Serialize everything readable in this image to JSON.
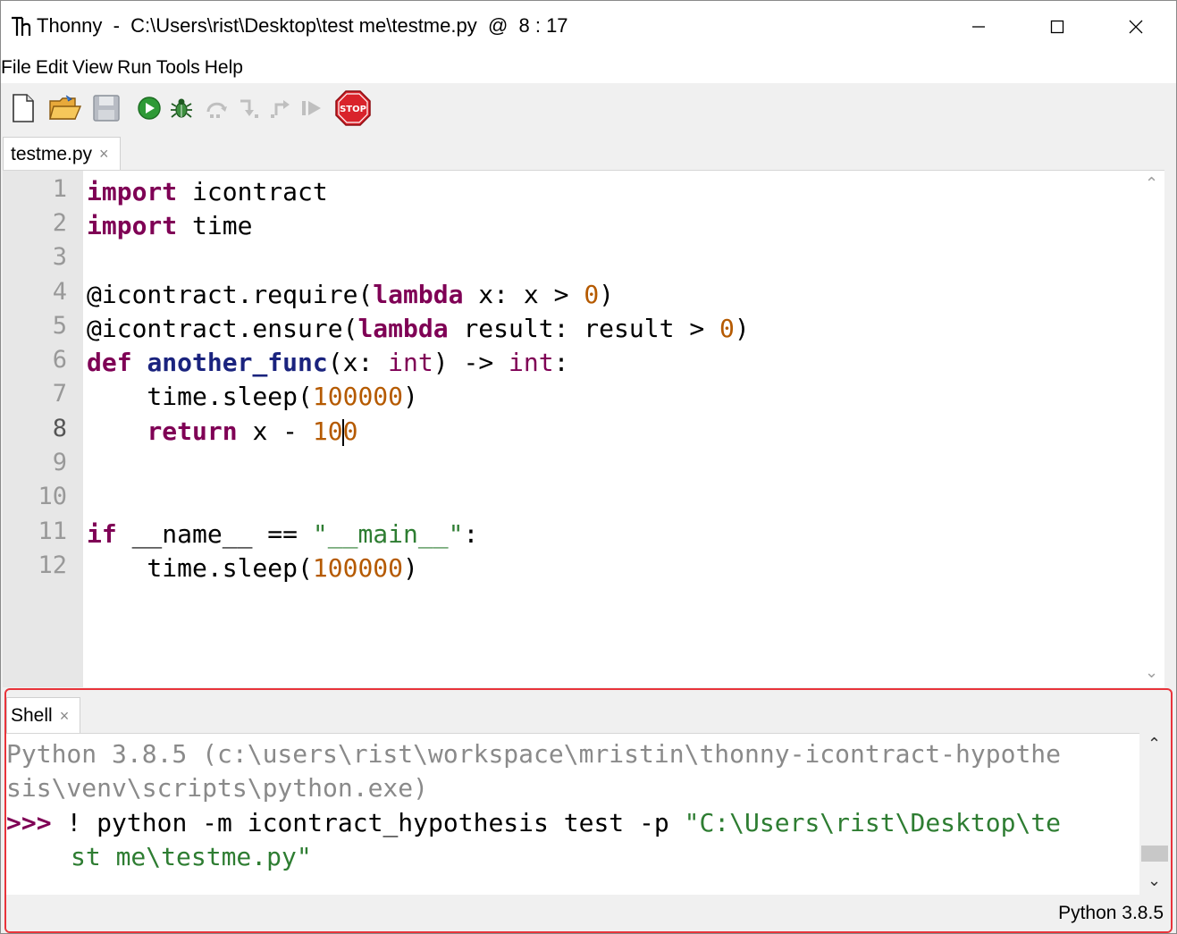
{
  "window": {
    "app_name": "Thonny",
    "separator": "  -  ",
    "path": "C:\\Users\\rist\\Desktop\\test me\\testme.py",
    "position_label": "  @  8 : 17"
  },
  "menu": [
    "File",
    "Edit",
    "View",
    "Run",
    "Tools",
    "Help"
  ],
  "toolbar": {
    "icons": [
      "new-file-icon",
      "open-folder-icon",
      "save-icon",
      "run-icon",
      "debug-bug-icon",
      "step-over-icon",
      "step-into-icon",
      "step-out-icon",
      "resume-icon",
      "stop-icon"
    ],
    "stop_label": "STOP"
  },
  "editor": {
    "tab_label": "testme.py",
    "tab_close": "×",
    "line_numbers": [
      "1",
      "2",
      "3",
      "4",
      "5",
      "6",
      "7",
      "8",
      "9",
      "10",
      "11",
      "12"
    ],
    "lines": [
      "import icontract",
      "import time",
      "",
      "@icontract.require(lambda x: x > 0)",
      "@icontract.ensure(lambda result: result > 0)",
      "def another_func(x: int) -> int:",
      "    time.sleep(100000)",
      "    return x - 100",
      "",
      "",
      "if __name__ == \"__main__\":",
      "    time.sleep(100000)"
    ]
  },
  "shell": {
    "tab_label": "Shell",
    "tab_close": "×",
    "banner_line1": "Python 3.8.5 (c:\\users\\rist\\workspace\\mristin\\thonny-icontract-hypothe",
    "banner_line2": "sis\\venv\\scripts\\python.exe)",
    "prompt": ">>>",
    "command": " ! python -m icontract_hypothesis test -p ",
    "command_path_part1": "\"C:\\Users\\rist\\Desktop\\te",
    "command_path_part2": "st me\\testme.py\""
  },
  "status": {
    "interpreter": "Python 3.8.5"
  },
  "colors": {
    "keyword": "#7f0055",
    "number": "#b55a00",
    "string": "#2e7d32",
    "highlight_border": "#e8343b"
  }
}
